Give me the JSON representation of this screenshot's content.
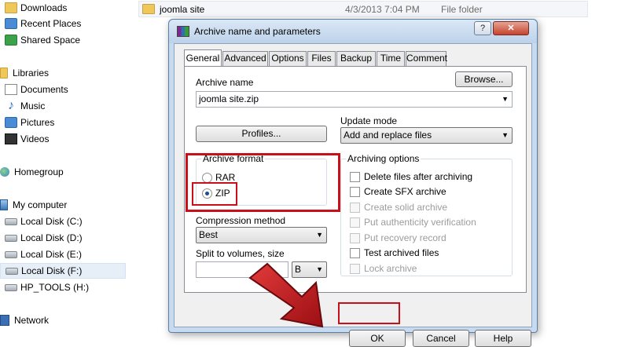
{
  "explorer": {
    "nav": [
      {
        "label": "Downloads",
        "icon": "downloads-folder-icon"
      },
      {
        "label": "Recent Places",
        "icon": "recent-places-icon"
      },
      {
        "label": "Shared Space",
        "icon": "shared-space-icon"
      },
      {
        "label": "Libraries",
        "icon": "libraries-icon"
      },
      {
        "label": "Documents",
        "icon": "documents-icon"
      },
      {
        "label": "Music",
        "icon": "music-icon"
      },
      {
        "label": "Pictures",
        "icon": "pictures-icon"
      },
      {
        "label": "Videos",
        "icon": "videos-icon"
      },
      {
        "label": "Homegroup",
        "icon": "homegroup-icon"
      },
      {
        "label": "My computer",
        "icon": "computer-icon"
      },
      {
        "label": "Local Disk (C:)",
        "icon": "drive-icon"
      },
      {
        "label": "Local Disk (D:)",
        "icon": "drive-icon"
      },
      {
        "label": "Local Disk (E:)",
        "icon": "drive-icon"
      },
      {
        "label": "Local Disk (F:)",
        "icon": "drive-icon"
      },
      {
        "label": "HP_TOOLS (H:)",
        "icon": "drive-icon"
      },
      {
        "label": "Network",
        "icon": "network-icon"
      }
    ],
    "selected_nav": "Local Disk (F:)",
    "file": {
      "name": "joomla site",
      "date": "4/3/2013 7:04 PM",
      "type": "File folder"
    }
  },
  "dialog": {
    "title": "Archive name and parameters",
    "help_glyph": "?",
    "close_glyph": "✕",
    "tabs": [
      "General",
      "Advanced",
      "Options",
      "Files",
      "Backup",
      "Time",
      "Comment"
    ],
    "active_tab": "General",
    "archive_name_label": "Archive name",
    "archive_name_value": "joomla site.zip",
    "browse_label": "Browse...",
    "profiles_label": "Profiles...",
    "update_mode_label": "Update mode",
    "update_mode_value": "Add and replace files",
    "archive_format": {
      "title": "Archive format",
      "options": [
        "RAR",
        "ZIP"
      ],
      "selected": "ZIP"
    },
    "compression_method_label": "Compression method",
    "compression_method_value": "Best",
    "split_label": "Split to volumes, size",
    "split_value": "",
    "split_unit": "B",
    "archiving_options": {
      "title": "Archiving options",
      "items": [
        {
          "label": "Delete files after archiving",
          "checked": false,
          "enabled": true
        },
        {
          "label": "Create SFX archive",
          "checked": false,
          "enabled": true
        },
        {
          "label": "Create solid archive",
          "checked": false,
          "enabled": false
        },
        {
          "label": "Put authenticity verification",
          "checked": false,
          "enabled": false
        },
        {
          "label": "Put recovery record",
          "checked": false,
          "enabled": false
        },
        {
          "label": "Test archived files",
          "checked": false,
          "enabled": true
        },
        {
          "label": "Lock archive",
          "checked": false,
          "enabled": false
        }
      ]
    },
    "ok_label": "OK",
    "cancel_label": "Cancel",
    "help_label": "Help"
  },
  "colors": {
    "highlight": "#c7101a",
    "arrow": "#c8161d"
  }
}
